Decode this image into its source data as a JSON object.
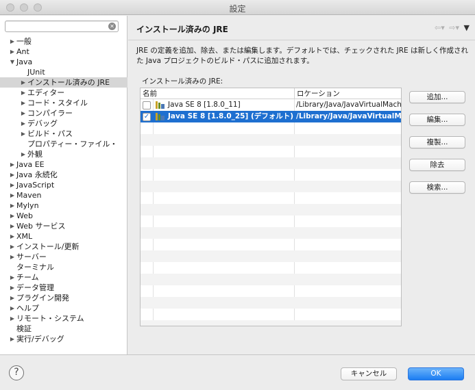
{
  "window": {
    "title": "設定"
  },
  "sidebar": {
    "filter_placeholder": "",
    "items": [
      {
        "label": "一般",
        "indent": 0,
        "arrow": "right"
      },
      {
        "label": "Ant",
        "indent": 0,
        "arrow": "right"
      },
      {
        "label": "Java",
        "indent": 0,
        "arrow": "down"
      },
      {
        "label": "JUnit",
        "indent": 2,
        "arrow": ""
      },
      {
        "label": "インストール済みの JRE",
        "indent": 2,
        "arrow": "right",
        "selected": true
      },
      {
        "label": "エディター",
        "indent": 2,
        "arrow": "right"
      },
      {
        "label": "コード・スタイル",
        "indent": 2,
        "arrow": "right"
      },
      {
        "label": "コンパイラー",
        "indent": 2,
        "arrow": "right"
      },
      {
        "label": "デバッグ",
        "indent": 2,
        "arrow": "right"
      },
      {
        "label": "ビルド・パス",
        "indent": 2,
        "arrow": "right"
      },
      {
        "label": "プロパティー・ファイル・",
        "indent": 2,
        "arrow": ""
      },
      {
        "label": "外観",
        "indent": 2,
        "arrow": "right"
      },
      {
        "label": "Java EE",
        "indent": 0,
        "arrow": "right"
      },
      {
        "label": "Java 永続化",
        "indent": 0,
        "arrow": "right"
      },
      {
        "label": "JavaScript",
        "indent": 0,
        "arrow": "right"
      },
      {
        "label": "Maven",
        "indent": 0,
        "arrow": "right"
      },
      {
        "label": "Mylyn",
        "indent": 0,
        "arrow": "right"
      },
      {
        "label": "Web",
        "indent": 0,
        "arrow": "right"
      },
      {
        "label": "Web サービス",
        "indent": 0,
        "arrow": "right"
      },
      {
        "label": "XML",
        "indent": 0,
        "arrow": "right"
      },
      {
        "label": "インストール/更新",
        "indent": 0,
        "arrow": "right"
      },
      {
        "label": "サーバー",
        "indent": 0,
        "arrow": "right"
      },
      {
        "label": "ターミナル",
        "indent": 0,
        "arrow": ""
      },
      {
        "label": "チーム",
        "indent": 0,
        "arrow": "right"
      },
      {
        "label": "データ管理",
        "indent": 0,
        "arrow": "right"
      },
      {
        "label": "プラグイン開発",
        "indent": 0,
        "arrow": "right"
      },
      {
        "label": "ヘルプ",
        "indent": 0,
        "arrow": "right"
      },
      {
        "label": "リモート・システム",
        "indent": 0,
        "arrow": "right"
      },
      {
        "label": "検証",
        "indent": 0,
        "arrow": ""
      },
      {
        "label": "実行/デバッグ",
        "indent": 0,
        "arrow": "right"
      }
    ]
  },
  "main": {
    "page_title": "インストール済みの JRE",
    "description": "JRE の定義を追加、除去、または編集します。デフォルトでは、チェックされた JRE は新しく作成された Java プロジェクトのビルド・パスに追加されます。",
    "jre_label": "インストール済みの JRE:",
    "table": {
      "columns": [
        "名前",
        "ロケーション"
      ],
      "rows": [
        {
          "checked": false,
          "name": "Java SE 8 [1.8.0_11]",
          "location": "/Library/Java/JavaVirtualMach",
          "selected": false
        },
        {
          "checked": true,
          "name": "Java SE 8 [1.8.0_25] (デフォルト)",
          "location": "/Library/Java/JavaVirtualMach",
          "selected": true
        }
      ],
      "empty_row_count": 18
    },
    "buttons": {
      "add": "追加...",
      "edit": "編集...",
      "copy": "複製...",
      "remove": "除去",
      "search": "検索..."
    }
  },
  "footer": {
    "cancel": "キャンセル",
    "ok": "OK"
  },
  "colors": {
    "selection": "#1e6fd0",
    "ok_button": "#1b7df2"
  }
}
